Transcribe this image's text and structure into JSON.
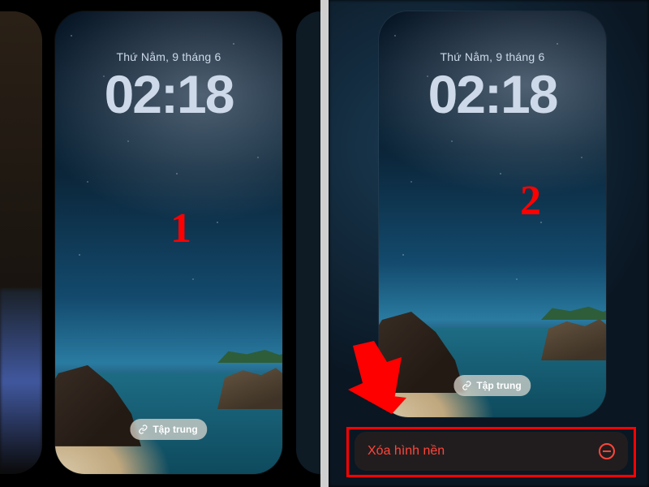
{
  "step1": {
    "number": "1"
  },
  "step2": {
    "number": "2"
  },
  "lockscreen": {
    "date": "Thứ Năm, 9 tháng 6",
    "time": "02:18",
    "focus_label": "Tập trung"
  },
  "delete_action": {
    "label": "Xóa hình nền"
  },
  "colors": {
    "annotation_red": "#ff0000",
    "destructive": "#ff453a",
    "clock": "#cdd9e9"
  }
}
